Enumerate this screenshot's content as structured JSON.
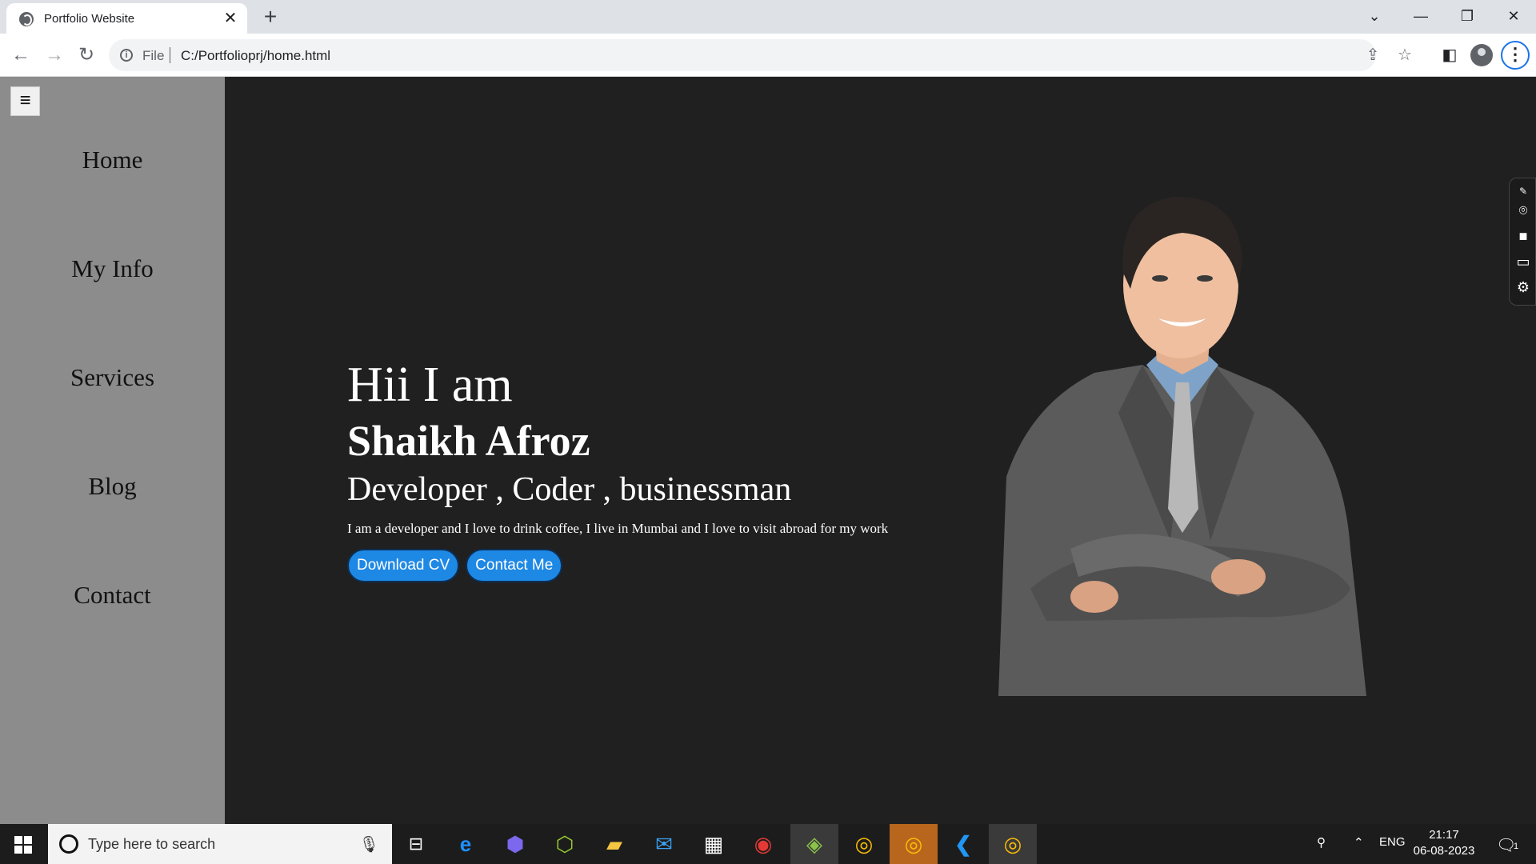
{
  "browser": {
    "tab_title": "Portfolio Website",
    "tab_close": "✕",
    "new_tab": "+",
    "url_scheme": "File",
    "url": "C:/Portfolioprj/home.html",
    "window_controls": {
      "dropdown": "⌄",
      "minimize": "—",
      "restore": "❐",
      "close": "✕"
    }
  },
  "sidebar": {
    "toggle_glyph": "≡",
    "items": [
      {
        "label": "Home"
      },
      {
        "label": "My Info"
      },
      {
        "label": "Services"
      },
      {
        "label": "Blog"
      },
      {
        "label": "Contact"
      }
    ]
  },
  "hero": {
    "greeting": "Hii I am",
    "name": "Shaikh Afroz",
    "roles": "Developer , Coder , businessman",
    "description": "I am a developer and I love to drink coffee, I live in Mumbai and I love to visit abroad for my work",
    "buttons": {
      "download": "Download CV",
      "contact": "Contact Me"
    }
  },
  "taskbar": {
    "search_placeholder": "Type here to search",
    "language": "ENG",
    "time": "21:17",
    "date": "06-08-2023",
    "notification_count": "1"
  },
  "colors": {
    "page_bg": "#202020",
    "sidebar_bg": "#8c8c8c",
    "button_bg": "#1e88e5"
  }
}
